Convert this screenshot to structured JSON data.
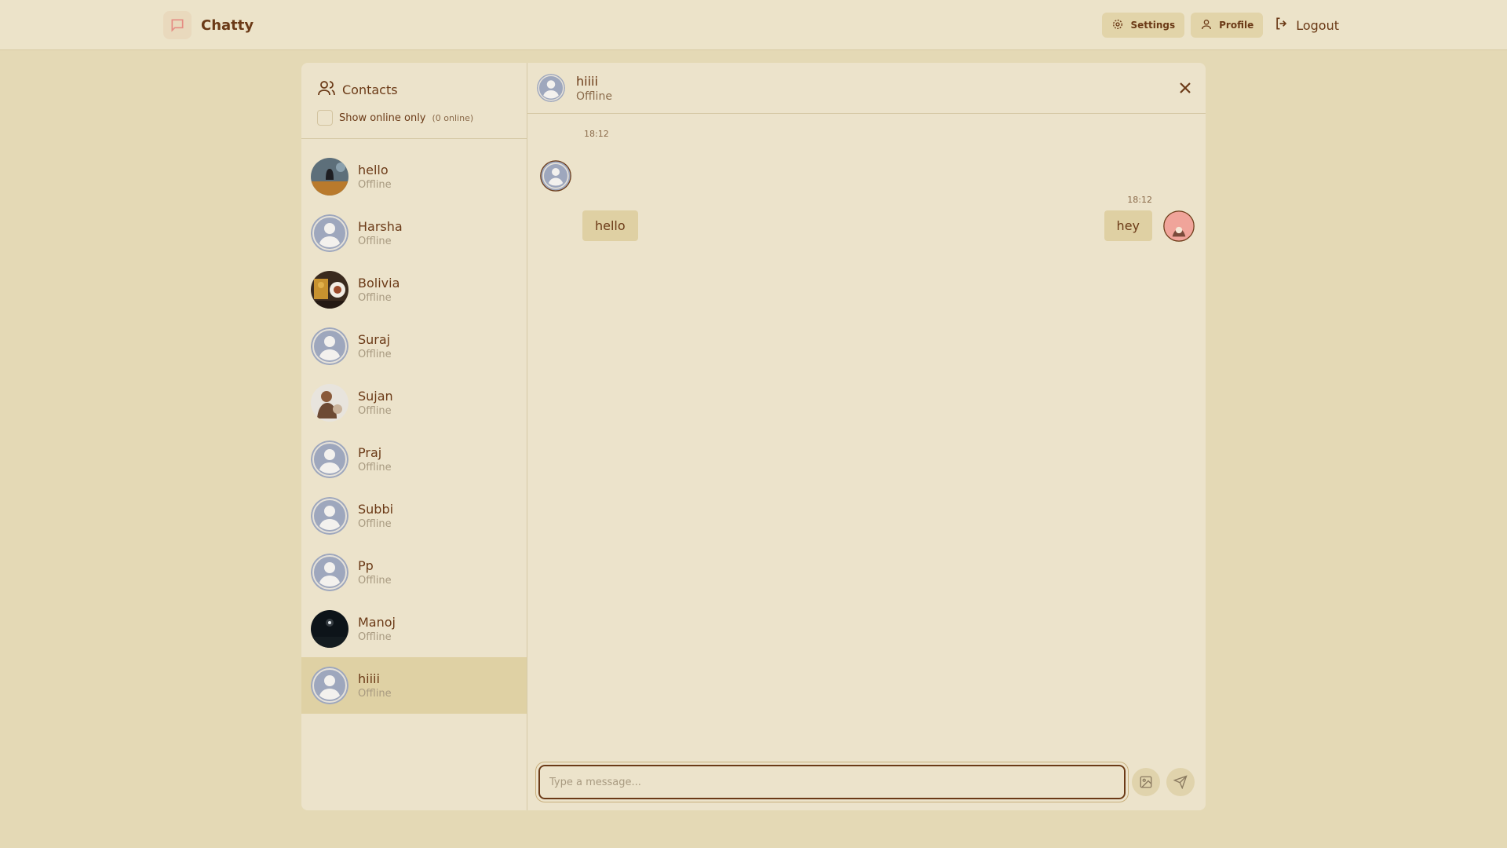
{
  "navbar": {
    "brand": "Chatty",
    "settings_label": "Settings",
    "profile_label": "Profile",
    "logout_label": "Logout"
  },
  "sidebar": {
    "title": "Contacts",
    "filter_label": "Show online only",
    "online_count": "(0 online)",
    "contacts": [
      {
        "name": "hello",
        "status": "Offline",
        "avatar": "photo-dark-landscape"
      },
      {
        "name": "Harsha",
        "status": "Offline",
        "avatar": "default-user"
      },
      {
        "name": "Bolivia",
        "status": "Offline",
        "avatar": "photo-food"
      },
      {
        "name": "Suraj",
        "status": "Offline",
        "avatar": "default-user"
      },
      {
        "name": "Sujan",
        "status": "Offline",
        "avatar": "photo-figure"
      },
      {
        "name": "Praj",
        "status": "Offline",
        "avatar": "default-user"
      },
      {
        "name": "Subbi",
        "status": "Offline",
        "avatar": "default-user"
      },
      {
        "name": "Pp",
        "status": "Offline",
        "avatar": "default-user"
      },
      {
        "name": "Manoj",
        "status": "Offline",
        "avatar": "photo-night-sky"
      },
      {
        "name": "hiiii",
        "status": "Offline",
        "avatar": "default-user"
      }
    ]
  },
  "chat": {
    "name": "hiiii",
    "status": "Offline",
    "messages": [
      {
        "time": "18:12",
        "text": "hello",
        "side": "left"
      },
      {
        "time": "18:12",
        "text": "hey",
        "side": "right"
      }
    ],
    "input_placeholder": "Type a message..."
  },
  "colors": {
    "background": "#e4d9b5",
    "panel": "#ece3cb",
    "accent": "#6b3a17",
    "bubble": "#dfd0a3",
    "selected": "#dfd1a4"
  }
}
